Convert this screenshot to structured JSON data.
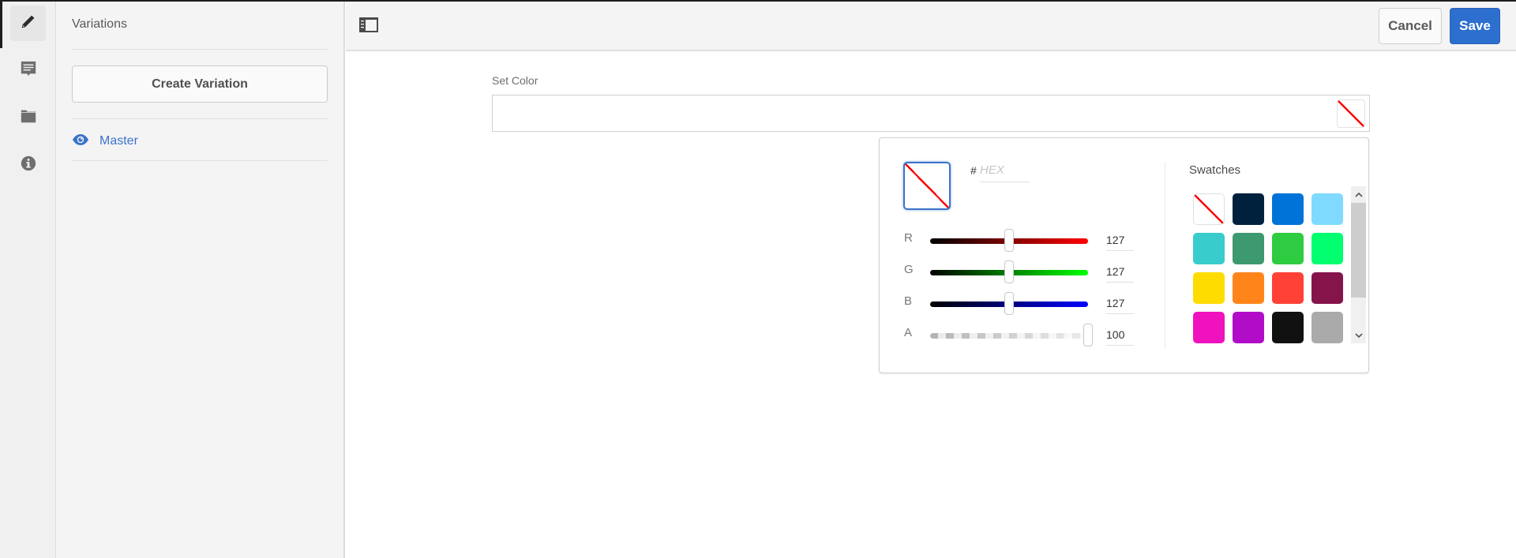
{
  "rail": {
    "items": [
      {
        "icon": "pencil-icon",
        "active": true
      },
      {
        "icon": "comment-icon",
        "active": false
      },
      {
        "icon": "folder-icon",
        "active": false
      },
      {
        "icon": "info-icon",
        "active": false
      }
    ]
  },
  "panel": {
    "title": "Variations",
    "create_button": "Create Variation",
    "variations": [
      {
        "label": "Master",
        "icon": "eye-icon"
      }
    ]
  },
  "toolbar": {
    "toggle_icon": "sidebar-toggle-icon",
    "cancel_label": "Cancel",
    "save_label": "Save"
  },
  "form": {
    "field_label": "Set Color",
    "value": ""
  },
  "color_picker": {
    "hex_prefix": "#",
    "hex_value": "",
    "hex_placeholder": "HEX",
    "channels": [
      {
        "label": "R",
        "value": "127",
        "max": 255
      },
      {
        "label": "G",
        "value": "127",
        "max": 255
      },
      {
        "label": "B",
        "value": "127",
        "max": 255
      },
      {
        "label": "A",
        "value": "100",
        "max": 100
      }
    ],
    "swatches_title": "Swatches",
    "swatches": [
      {
        "name": "none",
        "color": null
      },
      {
        "name": "navy",
        "color": "#00213d"
      },
      {
        "name": "blue",
        "color": "#0073d9"
      },
      {
        "name": "light-blue",
        "color": "#80daff"
      },
      {
        "name": "turquoise",
        "color": "#39cccc"
      },
      {
        "name": "sea-green",
        "color": "#3d9970"
      },
      {
        "name": "green",
        "color": "#2ecc40"
      },
      {
        "name": "lime",
        "color": "#01ff70"
      },
      {
        "name": "yellow",
        "color": "#ffdc00"
      },
      {
        "name": "orange",
        "color": "#ff851b"
      },
      {
        "name": "red",
        "color": "#ff4136"
      },
      {
        "name": "maroon",
        "color": "#85144b"
      },
      {
        "name": "fuchsia",
        "color": "#f012be"
      },
      {
        "name": "purple",
        "color": "#b10dc9"
      },
      {
        "name": "black",
        "color": "#111111"
      },
      {
        "name": "gray",
        "color": "#aaaaaa"
      }
    ]
  },
  "colors": {
    "accent": "#2d6fcf",
    "link": "#3a73c9"
  }
}
